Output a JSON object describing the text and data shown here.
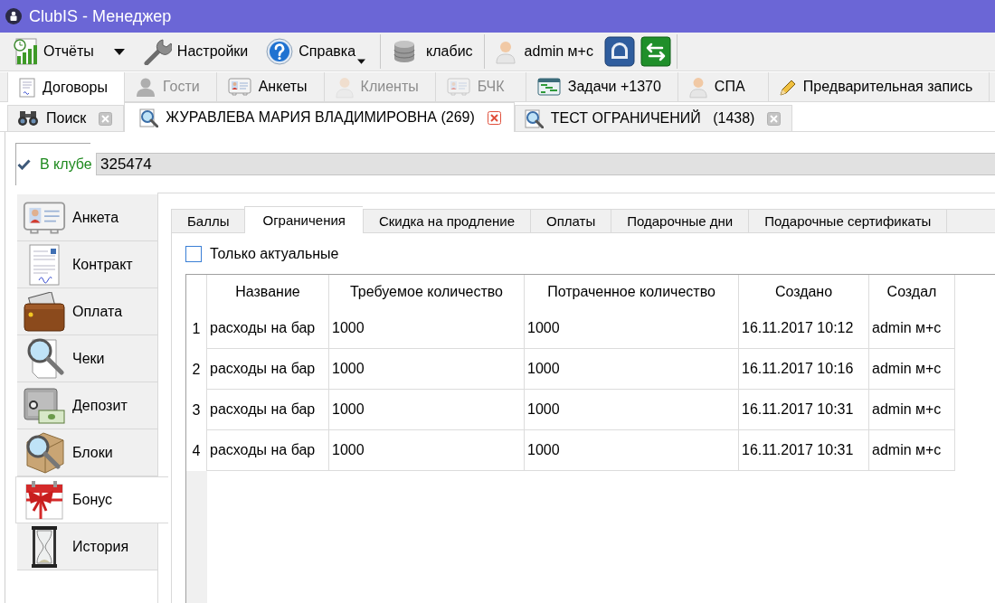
{
  "window": {
    "title": "ClubIS - Менеджер"
  },
  "toolbar": {
    "groups": [
      [
        {
          "kind": "split",
          "label": "Отчёты"
        },
        {
          "kind": "button",
          "label": "Настройки"
        },
        {
          "kind": "dropdown",
          "label": "Справка"
        }
      ],
      [
        {
          "kind": "label",
          "label": "клабис"
        }
      ],
      [
        {
          "kind": "label",
          "label": "admin м+с"
        },
        {
          "kind": "icon-button"
        },
        {
          "kind": "icon-button"
        }
      ]
    ]
  },
  "module_tabs": [
    {
      "label": "Договоры",
      "selected": true,
      "disabled": false
    },
    {
      "label": "Гости",
      "selected": false,
      "disabled": true
    },
    {
      "label": "Анкеты",
      "selected": false,
      "disabled": false
    },
    {
      "label": "Клиенты",
      "selected": false,
      "disabled": true
    },
    {
      "label": "БЧК",
      "selected": false,
      "disabled": true
    },
    {
      "label": "Задачи +1370",
      "selected": false,
      "disabled": false
    },
    {
      "label": "СПА",
      "selected": false,
      "disabled": false
    },
    {
      "label": "Предварительная запись",
      "selected": false,
      "disabled": false
    }
  ],
  "document_tabs": [
    {
      "label": "Поиск",
      "selected": false
    },
    {
      "label": "ЖУРАВЛЕВА МАРИЯ ВЛАДИМИРОВНА (269)",
      "selected": true
    },
    {
      "label": "ТЕСТ ОГРАНИЧЕНИЙ   (1438)",
      "selected": false
    }
  ],
  "client_status": {
    "label": "В клубе",
    "card_number": "325474"
  },
  "side_nav": [
    {
      "label": "Анкета",
      "selected": false
    },
    {
      "label": "Контракт",
      "selected": false
    },
    {
      "label": "Оплата",
      "selected": false
    },
    {
      "label": "Чеки",
      "selected": false
    },
    {
      "label": "Депозит",
      "selected": false
    },
    {
      "label": "Блоки",
      "selected": false
    },
    {
      "label": "Бонус",
      "selected": true
    },
    {
      "label": "История",
      "selected": false
    }
  ],
  "sub_tabs": [
    {
      "label": "Баллы",
      "selected": false
    },
    {
      "label": "Ограничения",
      "selected": true
    },
    {
      "label": "Скидка на продление",
      "selected": false
    },
    {
      "label": "Оплаты",
      "selected": false
    },
    {
      "label": "Подарочные дни",
      "selected": false
    },
    {
      "label": "Подарочные сертификаты",
      "selected": false
    }
  ],
  "filter": {
    "label": "Только актуальные",
    "checked": false
  },
  "table": {
    "columns": [
      "Название",
      "Требуемое количество",
      "Потраченное количество",
      "Создано",
      "Создал"
    ],
    "rows": [
      {
        "number": "1",
        "cells": [
          "расходы на бар",
          "1000",
          "1000",
          "16.11.2017 10:12",
          "admin м+с"
        ]
      },
      {
        "number": "2",
        "cells": [
          "расходы на бар",
          "1000",
          "1000",
          "16.11.2017 10:16",
          "admin м+с"
        ]
      },
      {
        "number": "3",
        "cells": [
          "расходы на бар",
          "1000",
          "1000",
          "16.11.2017 10:31",
          "admin м+с"
        ]
      },
      {
        "number": "4",
        "cells": [
          "расходы на бар",
          "1000",
          "1000",
          "16.11.2017 10:31",
          "admin м+с"
        ]
      }
    ]
  }
}
